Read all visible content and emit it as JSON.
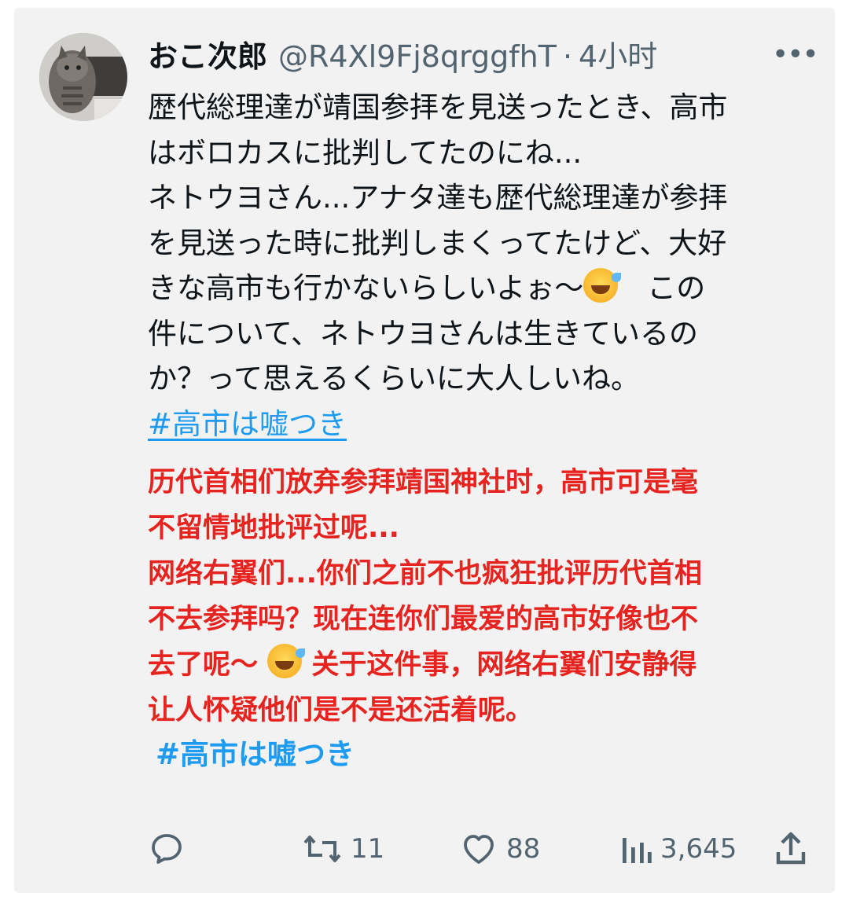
{
  "tweet": {
    "author_name": "おこ次郎",
    "handle": "@R4Xl9Fj8qrggfhT",
    "separator": "·",
    "time": "4小时",
    "more": "•••",
    "jp_lines": [
      "歴代総理達が靖国参拝を見送ったとき、高市",
      "はボロカスに批判してたのにね...",
      "ネトウヨさん...アナタ達も歴代総理達が参拝",
      "を見送った時に批判しまくってたけど、大好",
      "件について、ネトウヨさんは生きているの",
      "か？って思えるくらいに大人しいね。"
    ],
    "jp_emoji_line_before": "きな高市も行かないらしいよぉ〜",
    "jp_emoji_line_after": "　この",
    "hashtag": "#高市は嘘つき",
    "emoji": "rolling-on-floor-laughing-emoji"
  },
  "translation": {
    "lines": [
      "历代首相们放弃参拜靖国神社时，高市可是毫",
      "不留情地批评过呢...",
      "网络右翼们...你们之前不也疯狂批评历代首相",
      "不去参拜吗？现在连你们最爱的高市好像也不",
      "让人怀疑他们是不是还活着呢。"
    ],
    "emoji_line_before": "去了呢～",
    "emoji_line_after": "关于这件事，网络右翼们安静得",
    "hashtag": "#高市は嘘つき",
    "color": "#e6231f"
  },
  "actions": {
    "reply_icon": "reply-icon",
    "retweet_count": "11",
    "like_count": "88",
    "views_count": "3,645",
    "share_icon": "share-icon"
  },
  "colors": {
    "link": "#1d9bf0",
    "secondary": "#536471",
    "background": "#f2f2f2"
  }
}
